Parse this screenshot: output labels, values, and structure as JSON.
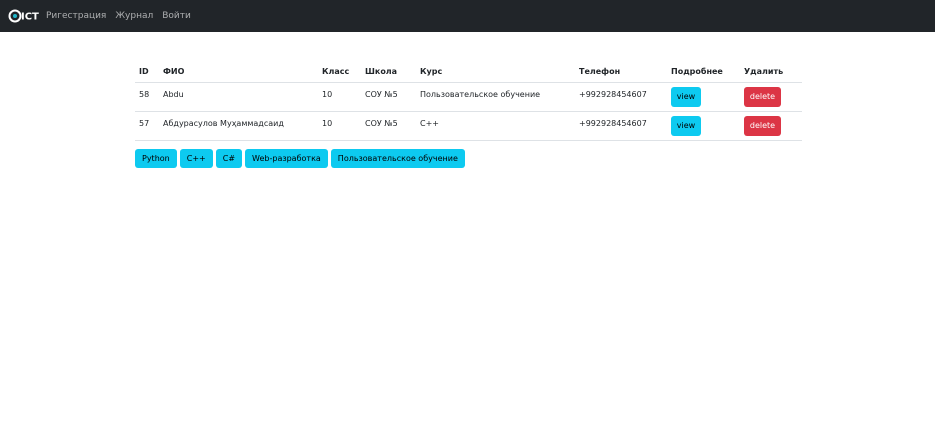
{
  "navbar": {
    "brand": "ICT",
    "links": [
      "Ригестрация",
      "Журнал",
      "Войти"
    ]
  },
  "table": {
    "headers": [
      "ID",
      "ФИО",
      "Класс",
      "Школа",
      "Курс",
      "Телефон",
      "Подробнее",
      "Удалить"
    ],
    "rows": [
      {
        "id": "58",
        "name": "Abdu",
        "class": "10",
        "school": "СОУ №5",
        "course": "Пользовательское обучение",
        "phone": "+992928454607",
        "view": "view",
        "delete": "delete"
      },
      {
        "id": "57",
        "name": "Абдурасулов Муҳаммадсаид",
        "class": "10",
        "school": "СОУ №5",
        "course": "C++",
        "phone": "+992928454607",
        "view": "view",
        "delete": "delete"
      }
    ]
  },
  "courses": [
    "Python",
    "C++",
    "C#",
    "Web-разработка",
    "Пользовательское обучение"
  ],
  "colors": {
    "navbar": "#212529",
    "info": "#0dcaf0",
    "danger": "#dc3545"
  }
}
